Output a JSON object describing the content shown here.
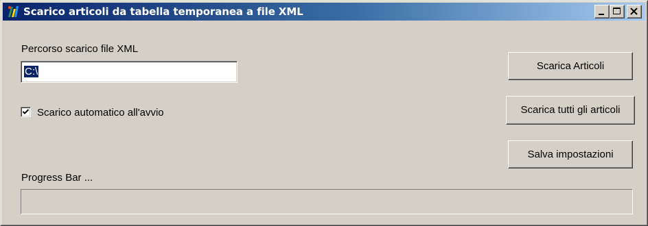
{
  "window": {
    "title": "Scarico articoli da tabella temporanea a file XML",
    "icon": "app-icon",
    "controls": [
      "minimize-icon",
      "maximize-icon",
      "close-icon"
    ]
  },
  "form": {
    "path_label": "Percorso scarico file XML",
    "path_value": "C:\\",
    "auto_download_label": "Scarico automatico all'avvio",
    "auto_download_checked": true,
    "progress_label": "Progress Bar ...",
    "progress_value": 0
  },
  "buttons": {
    "download_articles": "Scarica Articoli",
    "download_all_articles": "Scarica tutti gli articoli",
    "save_settings": "Salva impostazioni"
  },
  "colors": {
    "titlebar_start": "#0a246a",
    "titlebar_end": "#a6caf0",
    "face": "#d4d0c8",
    "selection": "#0a246a"
  }
}
